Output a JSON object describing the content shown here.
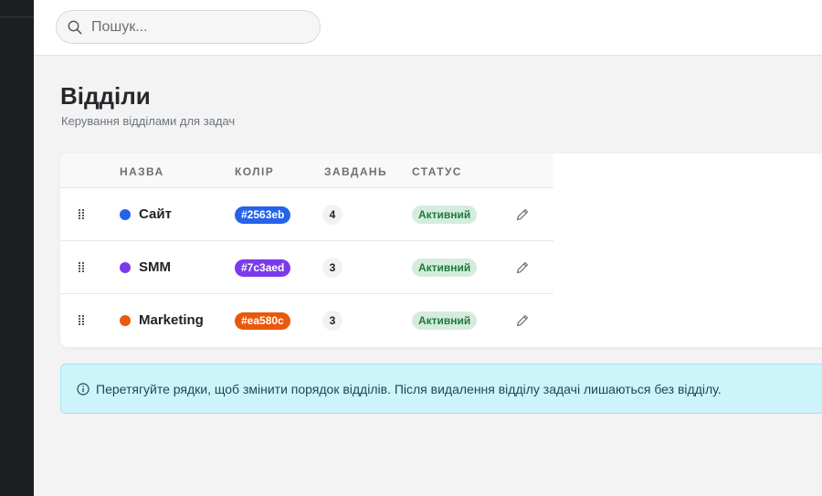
{
  "search": {
    "placeholder": "Пошук..."
  },
  "page": {
    "title": "Відділи",
    "subtitle": "Керування відділами для задач"
  },
  "table": {
    "headers": {
      "name": "НАЗВА",
      "color": "КОЛІР",
      "tasks": "ЗАВДАНЬ",
      "status": "СТАТУС"
    },
    "rows": [
      {
        "name": "Сайт",
        "color": "#2563eb",
        "color_label": "#2563eb",
        "tasks": "4",
        "status": "Активний"
      },
      {
        "name": "SMM",
        "color": "#7c3aed",
        "color_label": "#7c3aed",
        "tasks": "3",
        "status": "Активний"
      },
      {
        "name": "Marketing",
        "color": "#ea580c",
        "color_label": "#ea580c",
        "tasks": "3",
        "status": "Активний"
      }
    ]
  },
  "info": {
    "text": "Перетягуйте рядки, щоб змінити порядок відділів. Після видалення відділу задачі лишаються без відділу."
  },
  "icons": {
    "search": "search-icon",
    "drag": "drag-handle-icon",
    "edit": "pencil-icon",
    "info": "info-circle-icon"
  },
  "colors": {
    "status_bg": "#d5ecdc",
    "status_text": "#1f7a3c",
    "info_bg": "#cdf3fb",
    "sidebar_bg": "#1d1f23"
  }
}
